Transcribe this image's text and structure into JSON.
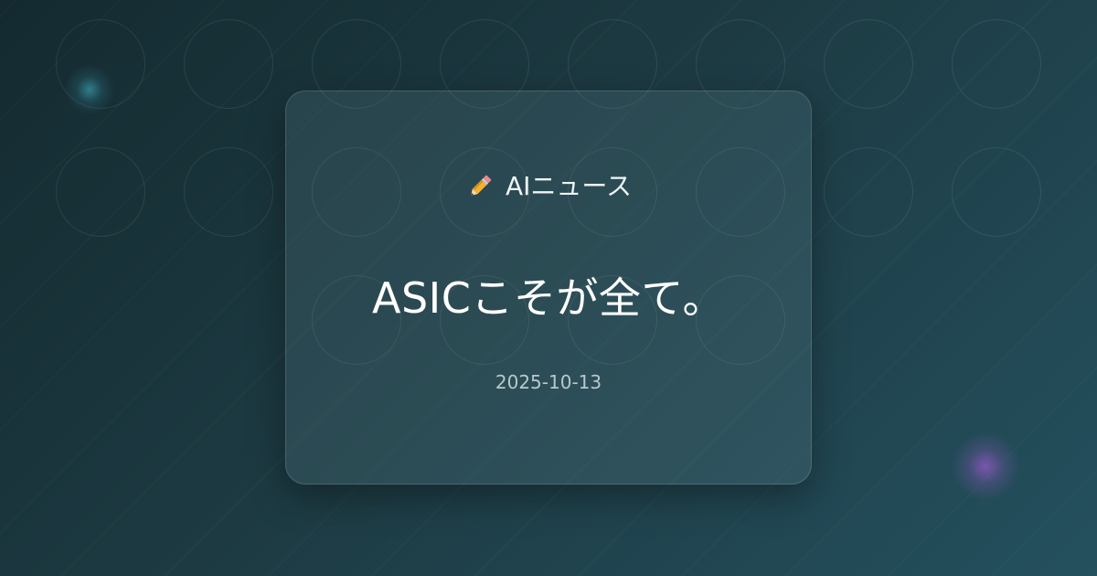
{
  "post": {
    "category_icon": "pencil-icon",
    "category": "AIニュース",
    "title": "ASICこそが全て。",
    "date": "2025-10-13"
  },
  "colors": {
    "background_start": "#142a30",
    "background_end": "#24505e",
    "glow_teal": "#46bed2",
    "glow_purple": "#965ac8",
    "text_primary": "#ffffff",
    "text_secondary": "#b9c8cc"
  }
}
